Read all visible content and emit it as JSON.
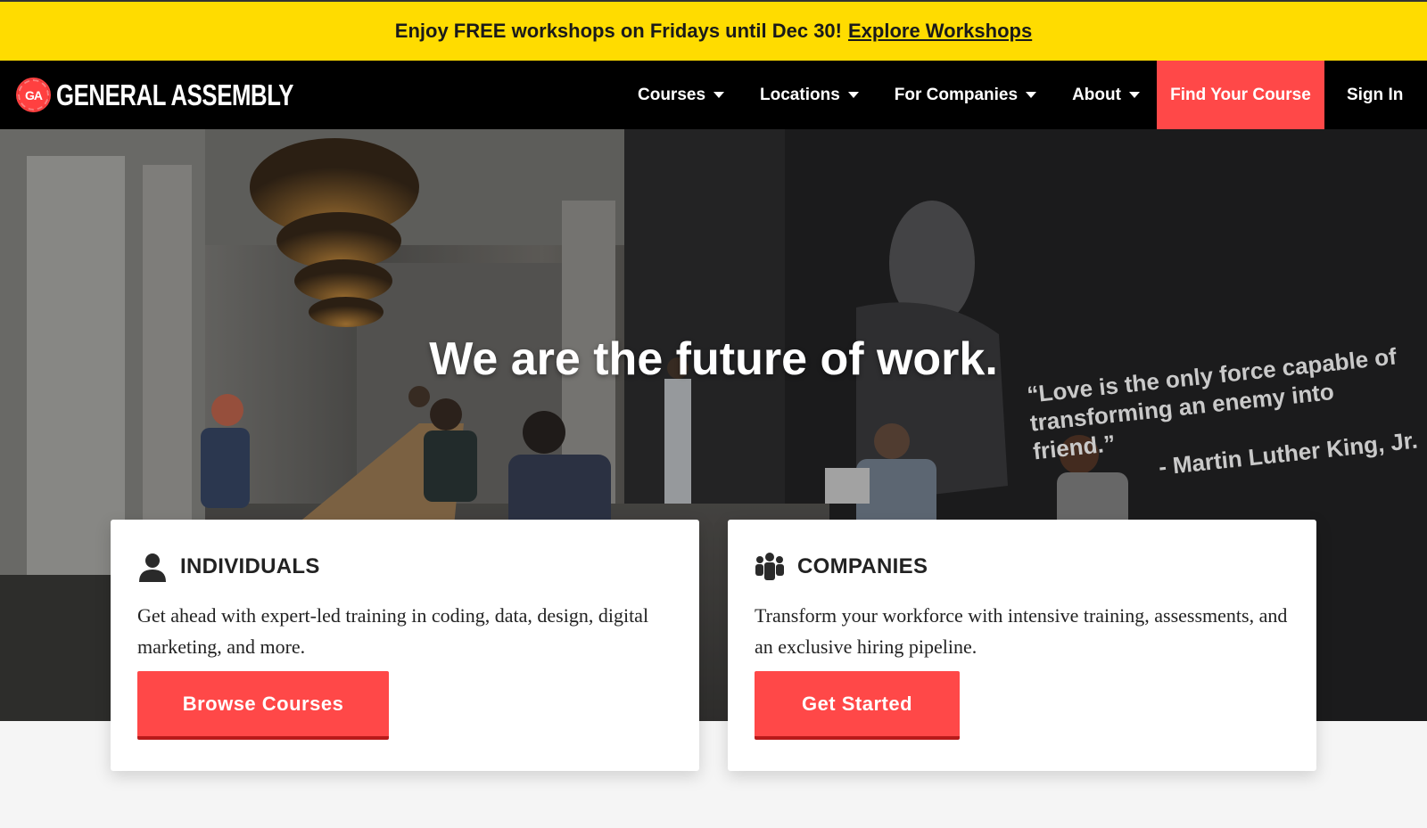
{
  "promo": {
    "text": "Enjoy FREE workshops on Fridays until Dec 30!",
    "link": "Explore Workshops"
  },
  "nav": {
    "logo_badge": "GA",
    "logo_text": "GENERAL ASSEMBLY",
    "items": [
      {
        "label": "Courses"
      },
      {
        "label": "Locations"
      },
      {
        "label": "For Companies"
      },
      {
        "label": "About"
      }
    ],
    "cta": "Find Your Course",
    "sign_in": "Sign In"
  },
  "hero": {
    "title": "We are the future of work.",
    "quote_line1": "“Love is the only force capable of",
    "quote_line2": "transforming an enemy into friend.”",
    "quote_attribution": "- Martin Luther King, Jr."
  },
  "cards": {
    "individuals": {
      "title": "INDIVIDUALS",
      "body": "Get ahead with expert-led training in coding, data, design, digital marketing, and more.",
      "button": "Browse Courses",
      "icon": "person-icon"
    },
    "companies": {
      "title": "COMPANIES",
      "body": "Transform your workforce with intensive training, assessments, and an exclusive hiring pipeline.",
      "button": "Get Started",
      "icon": "group-icon"
    }
  },
  "colors": {
    "promo_bg": "#ffdc00",
    "accent": "#ff4848",
    "nav_bg": "#000000"
  }
}
